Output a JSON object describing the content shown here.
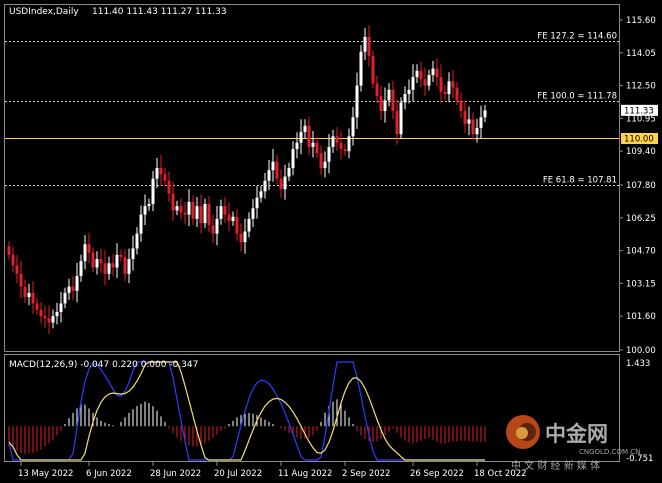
{
  "header": {
    "symbol": "USDIndex,Daily",
    "ohlc": "111.40 111.43 111.27 111.33"
  },
  "indicator": {
    "label": "MACD(12,26,9) -0.047 0.220 0.000 -0.347",
    "top_value": "1.433",
    "bottom_value": "-0.751"
  },
  "levels": [
    {
      "label": "FE 127.2 = 114.60",
      "value": 114.6
    },
    {
      "label": "FE 100.0 = 111.78",
      "value": 111.78
    },
    {
      "label": "FE 61.8 = 107.81",
      "value": 107.81
    }
  ],
  "support": {
    "label": "110.00",
    "value": 110.0,
    "color": "#ffd24a"
  },
  "current_price": {
    "label": "111.33",
    "value": 111.33
  },
  "watermark": {
    "brand": "中金网",
    "site": "CNGOLD.COM.CN",
    "tagline": "中 文 财 经 新 媒 体"
  },
  "chart_data": {
    "type": "candlestick",
    "title": "",
    "y_ticks": [
      "115.60",
      "114.05",
      "112.50",
      "110.95",
      "109.40",
      "107.80",
      "106.25",
      "104.70",
      "103.15",
      "101.60",
      "100.00"
    ],
    "ylim": [
      100.0,
      116.4
    ],
    "x_ticks": [
      {
        "label": "13 May 2022",
        "bar": 3
      },
      {
        "label": "6 Jun 2022",
        "bar": 20
      },
      {
        "label": "28 Jun 2022",
        "bar": 36
      },
      {
        "label": "20 Jul 2022",
        "bar": 52
      },
      {
        "label": "11 Aug 2022",
        "bar": 68
      },
      {
        "label": "2 Sep 2022",
        "bar": 84
      },
      {
        "label": "26 Sep 2022",
        "bar": 101
      },
      {
        "label": "18 Oct 2022",
        "bar": 117
      }
    ],
    "bull_color": "#ffffff",
    "bear_color": "#e0202a",
    "closes": [
      104.5,
      104.0,
      103.6,
      103.0,
      102.5,
      102.7,
      102.2,
      101.9,
      101.6,
      101.5,
      101.3,
      101.6,
      101.8,
      102.2,
      102.7,
      103.0,
      102.8,
      103.5,
      104.2,
      105.0,
      104.6,
      103.9,
      104.3,
      104.1,
      103.6,
      104.1,
      103.9,
      104.5,
      104.4,
      103.6,
      104.3,
      104.8,
      105.5,
      106.4,
      106.8,
      106.9,
      108.1,
      108.6,
      108.3,
      108.0,
      107.4,
      106.6,
      106.8,
      106.5,
      106.4,
      107.0,
      106.2,
      106.8,
      106.0,
      106.9,
      105.9,
      105.5,
      106.2,
      106.8,
      106.4,
      106.1,
      106.3,
      105.5,
      105.1,
      105.6,
      106.2,
      106.7,
      107.2,
      107.5,
      108.0,
      108.5,
      108.9,
      108.1,
      107.6,
      108.2,
      108.6,
      109.5,
      109.8,
      110.3,
      110.6,
      109.6,
      109.8,
      109.3,
      108.6,
      108.9,
      109.6,
      110.1,
      109.8,
      109.5,
      109.4,
      110.1,
      111.0,
      112.5,
      114.1,
      114.8,
      113.9,
      112.6,
      112.0,
      111.3,
      111.8,
      112.3,
      111.3,
      110.2,
      111.7,
      112.1,
      112.3,
      112.9,
      113.2,
      112.8,
      112.5,
      113.0,
      113.3,
      112.9,
      112.2,
      112.1,
      112.7,
      112.4,
      111.8,
      111.3,
      110.7,
      110.9,
      110.2,
      110.5,
      111.0,
      111.33
    ],
    "macd_hist": [
      -0.45,
      -0.5,
      -0.55,
      -0.6,
      -0.62,
      -0.6,
      -0.58,
      -0.55,
      -0.52,
      -0.45,
      -0.38,
      -0.3,
      -0.2,
      -0.1,
      0.05,
      0.18,
      0.3,
      0.4,
      0.5,
      0.48,
      0.4,
      0.3,
      0.2,
      0.12,
      0.08,
      0.05,
      0.02,
      0.0,
      0.1,
      0.2,
      0.3,
      0.38,
      0.45,
      0.5,
      0.55,
      0.52,
      0.45,
      0.35,
      0.22,
      0.1,
      -0.05,
      -0.15,
      -0.25,
      -0.32,
      -0.38,
      -0.42,
      -0.45,
      -0.45,
      -0.42,
      -0.38,
      -0.32,
      -0.25,
      -0.18,
      -0.1,
      -0.05,
      0.05,
      0.12,
      0.2,
      0.25,
      0.28,
      0.3,
      0.28,
      0.25,
      0.2,
      0.15,
      0.1,
      0.05,
      0.0,
      -0.05,
      -0.1,
      -0.15,
      -0.2,
      -0.25,
      -0.28,
      -0.28,
      -0.25,
      -0.2,
      -0.1,
      0.1,
      0.3,
      0.45,
      0.55,
      0.6,
      0.5,
      0.35,
      0.2,
      0.05,
      -0.1,
      -0.2,
      -0.28,
      -0.33,
      -0.35,
      -0.33,
      -0.28,
      -0.2,
      -0.12,
      -0.05,
      -0.15,
      -0.25,
      -0.32,
      -0.36,
      -0.38,
      -0.36,
      -0.32,
      -0.28,
      -0.25,
      -0.3,
      -0.35,
      -0.38,
      -0.38,
      -0.36,
      -0.34,
      -0.33,
      -0.32,
      -0.32,
      -0.33,
      -0.34,
      -0.34,
      -0.35,
      -0.347
    ]
  }
}
